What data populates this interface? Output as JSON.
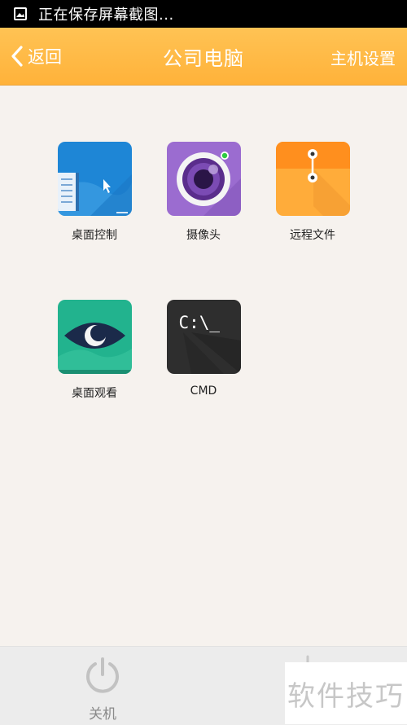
{
  "status_bar": {
    "icon": "image-icon",
    "text": "正在保存屏幕截图..."
  },
  "header": {
    "back_label": "返回",
    "title": "公司电脑",
    "settings_label": "主机设置"
  },
  "apps": [
    {
      "name": "desktop-control",
      "label": "桌面控制",
      "icon": "desktop-cursor-icon",
      "color": "#1e86d6"
    },
    {
      "name": "camera",
      "label": "摄像头",
      "icon": "camera-lens-icon",
      "color": "#9b6cd0"
    },
    {
      "name": "remote-files",
      "label": "远程文件",
      "icon": "folder-envelope-icon",
      "color": "#ff9f2c"
    },
    {
      "name": "desktop-view",
      "label": "桌面观看",
      "icon": "eye-icon",
      "color": "#22b38e"
    },
    {
      "name": "cmd",
      "label": "CMD",
      "icon": "terminal-icon",
      "color": "#2e2e2e",
      "tile_text": "C:\\_"
    }
  ],
  "bottom_bar": {
    "shutdown_label": "关机",
    "icon": "power-icon"
  },
  "watermark": "软件技巧"
}
